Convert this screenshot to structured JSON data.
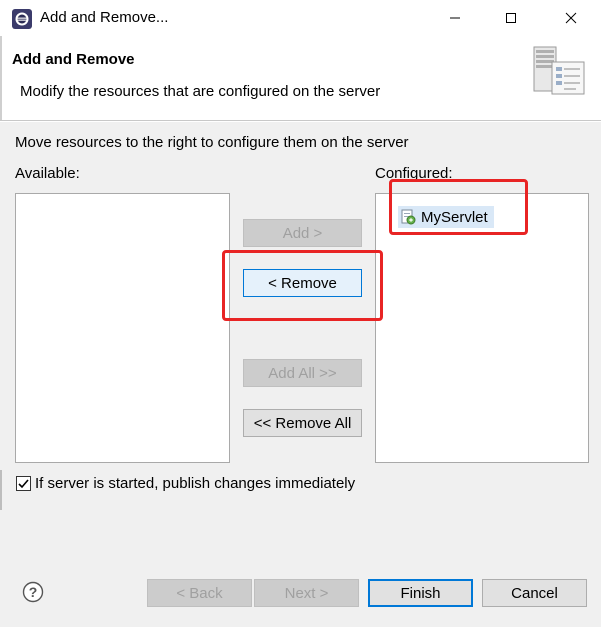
{
  "window": {
    "title": "Add and Remove...",
    "controls": [
      "minimize-icon",
      "maximize-icon",
      "close-icon"
    ]
  },
  "banner": {
    "title": "Add and Remove",
    "message": "Modify the resources that are configured on the server",
    "image": "server-config-icon"
  },
  "body": {
    "instruction": "Move resources to the right to configure them on the server",
    "available_label": "Available:",
    "configured_label": "Configured:",
    "available_items": [],
    "configured_items": [
      {
        "label": "MyServlet",
        "icon": "web-module-icon",
        "selected": true
      }
    ],
    "buttons": {
      "add": "Add >",
      "remove": "< Remove",
      "add_all": "Add All >>",
      "remove_all": "<< Remove All"
    },
    "publish_checkbox": {
      "checked": true,
      "label": "If server is started, publish changes immediately"
    }
  },
  "footer": {
    "help_icon": "help-icon",
    "back": "< Back",
    "next": "Next >",
    "finish": "Finish",
    "cancel": "Cancel"
  },
  "annotations": {
    "highlight_color": "#e82424",
    "highlighted": [
      "configured-item-myservlet",
      "remove-button"
    ]
  },
  "colors": {
    "accent": "#0078d7",
    "selection": "#d9e8f7",
    "disabled_text": "#a0a0a0"
  }
}
